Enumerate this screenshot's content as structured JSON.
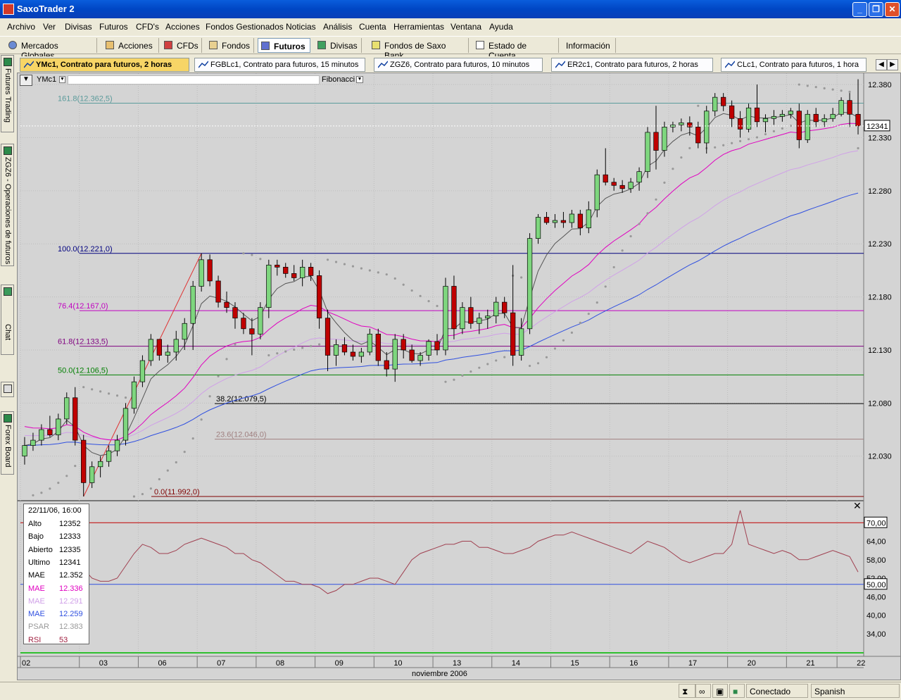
{
  "window": {
    "title": "SaxoTrader 2",
    "btn_min": "_",
    "btn_max": "❐",
    "btn_close": "✕"
  },
  "menu": [
    "Archivo",
    "Ver",
    "Divisas",
    "Futuros",
    "CFD's",
    "Acciones",
    "Fondos Gestionados",
    "Noticias",
    "Análisis",
    "Cuenta",
    "Herramientas",
    "Ventana",
    "Ayuda"
  ],
  "toolbar": [
    "Mercados Globales",
    "Acciones",
    "CFDs",
    "Fondos",
    "Futuros",
    "Divisas",
    "Fondos de Saxo Bank",
    "Estado de Cuenta",
    "Información"
  ],
  "toolbar_active": "Futuros",
  "left_tabs": [
    "Futures Trading",
    "ZGZ6 - Operaciones de futuros",
    "Chat",
    "Forex Board"
  ],
  "doc_tabs": [
    "YMc1, Contrato para futuros, 2 horas",
    "FGBLc1, Contrato para futuros, 15 minutos",
    "ZGZ6, Contrato para futuros, 10 minutos",
    "ER2c1, Contrato para futuros, 2 horas",
    "CLc1, Contrato para futuros, 1 hora"
  ],
  "chart_toolbar": {
    "symbol": "YMc1",
    "study": "Fibonacci"
  },
  "chart_data": {
    "type": "candlestick",
    "symbol": "YMc1",
    "price_axis_labels": [
      "12.380",
      "12.330",
      "12.280",
      "12.230",
      "12.180",
      "12.130",
      "12.080",
      "12.030"
    ],
    "price_range": [
      11990,
      12388
    ],
    "last_price_label": "12341",
    "fibonacci_levels": [
      {
        "label": "161.8(12.362,5)",
        "value": 12362.5,
        "color": "#5b9b9b"
      },
      {
        "label": "100.0(12.221,0)",
        "value": 12221,
        "color": "#00007f"
      },
      {
        "label": "76.4(12.167,0)",
        "value": 12167,
        "color": "#c000c0"
      },
      {
        "label": "61.8(12.133,5)",
        "value": 12133.5,
        "color": "#7f007f"
      },
      {
        "label": "50.0(12.106,5)",
        "value": 12106.5,
        "color": "#007f00"
      },
      {
        "label": "38.2(12.079,5)",
        "value": 12079.5,
        "color": "#000000"
      },
      {
        "label": "23.6(12.046,0)",
        "value": 12046,
        "color": "#9f7f7f"
      },
      {
        "label": "0.0(11.992,0)",
        "value": 11992,
        "color": "#7f0000"
      }
    ],
    "candles": [
      [
        12030,
        12048,
        12022,
        12040
      ],
      [
        12040,
        12052,
        12035,
        12045
      ],
      [
        12045,
        12060,
        12040,
        12055
      ],
      [
        12055,
        12068,
        12048,
        12050
      ],
      [
        12050,
        12070,
        12045,
        12065
      ],
      [
        12065,
        12090,
        12060,
        12085
      ],
      [
        12085,
        12095,
        12040,
        12045
      ],
      [
        12045,
        12050,
        11992,
        12005
      ],
      [
        12005,
        12025,
        12000,
        12020
      ],
      [
        12020,
        12030,
        12010,
        12025
      ],
      [
        12025,
        12040,
        12020,
        12035
      ],
      [
        12035,
        12050,
        12030,
        12045
      ],
      [
        12045,
        12080,
        12040,
        12075
      ],
      [
        12075,
        12105,
        12070,
        12100
      ],
      [
        12100,
        12125,
        12095,
        12120
      ],
      [
        12120,
        12145,
        12115,
        12140
      ],
      [
        12140,
        12140,
        12120,
        12125
      ],
      [
        12125,
        12135,
        12118,
        12128
      ],
      [
        12128,
        12148,
        12120,
        12140
      ],
      [
        12140,
        12160,
        12130,
        12155
      ],
      [
        12155,
        12195,
        12130,
        12190
      ],
      [
        12190,
        12221,
        12185,
        12215
      ],
      [
        12215,
        12220,
        12190,
        12195
      ],
      [
        12195,
        12200,
        12170,
        12175
      ],
      [
        12175,
        12185,
        12165,
        12170
      ],
      [
        12170,
        12175,
        12150,
        12160
      ],
      [
        12160,
        12165,
        12145,
        12150
      ],
      [
        12150,
        12160,
        12125,
        12145
      ],
      [
        12145,
        12175,
        12140,
        12170
      ],
      [
        12170,
        12215,
        12160,
        12210
      ],
      [
        12210,
        12215,
        12200,
        12208
      ],
      [
        12208,
        12212,
        12198,
        12202
      ],
      [
        12202,
        12210,
        12195,
        12198
      ],
      [
        12198,
        12215,
        12190,
        12208
      ],
      [
        12208,
        12212,
        12195,
        12200
      ],
      [
        12200,
        12205,
        12150,
        12160
      ],
      [
        12160,
        12168,
        12110,
        12125
      ],
      [
        12125,
        12140,
        12115,
        12135
      ],
      [
        12135,
        12142,
        12125,
        12128
      ],
      [
        12128,
        12135,
        12120,
        12124
      ],
      [
        12124,
        12132,
        12118,
        12128
      ],
      [
        12128,
        12150,
        12125,
        12145
      ],
      [
        12145,
        12150,
        12115,
        12120
      ],
      [
        12120,
        12128,
        12105,
        12112
      ],
      [
        12112,
        12145,
        12100,
        12140
      ],
      [
        12140,
        12145,
        12122,
        12130
      ],
      [
        12130,
        12135,
        12118,
        12120
      ],
      [
        12120,
        12128,
        12115,
        12125
      ],
      [
        12125,
        12140,
        12120,
        12138
      ],
      [
        12138,
        12145,
        12125,
        12130
      ],
      [
        12130,
        12198,
        12125,
        12190
      ],
      [
        12190,
        12200,
        12140,
        12150
      ],
      [
        12150,
        12175,
        12145,
        12170
      ],
      [
        12170,
        12180,
        12150,
        12155
      ],
      [
        12155,
        12165,
        12145,
        12160
      ],
      [
        12160,
        12168,
        12150,
        12162
      ],
      [
        12162,
        12180,
        12155,
        12175
      ],
      [
        12175,
        12180,
        12160,
        12165
      ],
      [
        12165,
        12210,
        12115,
        12125
      ],
      [
        12125,
        12160,
        12120,
        12150
      ],
      [
        12150,
        12240,
        12145,
        12235
      ],
      [
        12235,
        12258,
        12230,
        12255
      ],
      [
        12255,
        12260,
        12248,
        12250
      ],
      [
        12250,
        12258,
        12245,
        12252
      ],
      [
        12252,
        12260,
        12245,
        12250
      ],
      [
        12250,
        12262,
        12245,
        12258
      ],
      [
        12258,
        12262,
        12238,
        12245
      ],
      [
        12245,
        12270,
        12240,
        12262
      ],
      [
        12262,
        12300,
        12255,
        12295
      ],
      [
        12295,
        12320,
        12285,
        12288
      ],
      [
        12288,
        12292,
        12280,
        12285
      ],
      [
        12285,
        12290,
        12278,
        12282
      ],
      [
        12282,
        12292,
        12278,
        12288
      ],
      [
        12288,
        12302,
        12280,
        12298
      ],
      [
        12298,
        12340,
        12292,
        12335
      ],
      [
        12335,
        12360,
        12300,
        12318
      ],
      [
        12318,
        12345,
        12312,
        12340
      ],
      [
        12340,
        12345,
        12335,
        12342
      ],
      [
        12342,
        12348,
        12336,
        12344
      ],
      [
        12344,
        12350,
        12332,
        12340
      ],
      [
        12340,
        12345,
        12320,
        12325
      ],
      [
        12325,
        12360,
        12315,
        12355
      ],
      [
        12355,
        12372,
        12350,
        12368
      ],
      [
        12368,
        12372,
        12355,
        12360
      ],
      [
        12360,
        12365,
        12340,
        12348
      ],
      [
        12348,
        12355,
        12330,
        12338
      ],
      [
        12338,
        12362,
        12335,
        12358
      ],
      [
        12358,
        12380,
        12340,
        12345
      ],
      [
        12345,
        12352,
        12335,
        12348
      ],
      [
        12348,
        12356,
        12342,
        12350
      ],
      [
        12350,
        12356,
        12345,
        12352
      ],
      [
        12352,
        12358,
        12348,
        12355
      ],
      [
        12355,
        12362,
        12320,
        12328
      ],
      [
        12328,
        12356,
        12325,
        12352
      ],
      [
        12352,
        12358,
        12340,
        12345
      ],
      [
        12345,
        12352,
        12340,
        12348
      ],
      [
        12348,
        12358,
        12345,
        12352
      ],
      [
        12352,
        12368,
        12350,
        12365
      ],
      [
        12365,
        12372,
        12340,
        12352
      ],
      [
        12352,
        12385,
        12333,
        12341
      ]
    ],
    "rsi_axis_labels": [
      "70,00",
      "64,00",
      "58,00",
      "52,00",
      "50,00",
      "46,00",
      "40,00",
      "34,00"
    ],
    "rsi_range": [
      28,
      76
    ],
    "rsi_values": [
      40,
      40,
      41,
      42,
      44,
      48,
      53,
      55,
      52,
      51,
      51,
      52,
      56,
      60,
      63,
      62,
      60,
      60,
      61,
      63,
      64,
      65,
      64,
      63,
      62,
      60,
      60,
      58,
      57,
      55,
      53,
      51,
      51,
      50,
      50,
      49,
      47,
      48,
      50,
      50,
      51,
      52,
      52,
      51,
      50,
      54,
      58,
      60,
      61,
      62,
      63,
      63,
      64,
      64,
      62,
      62,
      61,
      60,
      60,
      61,
      62,
      64,
      65,
      66,
      66,
      67,
      66,
      65,
      64,
      63,
      62,
      61,
      60,
      62,
      64,
      63,
      62,
      60,
      58,
      57,
      58,
      59,
      60,
      60,
      63,
      74,
      63,
      62,
      61,
      60,
      61,
      60,
      58,
      58,
      59,
      60,
      61,
      60,
      59,
      54
    ],
    "legend": {
      "datetime": "22/11/06, 16:00",
      "rows": [
        {
          "label": "Alto",
          "value": "12352",
          "color": "#000000"
        },
        {
          "label": "Bajo",
          "value": "12333",
          "color": "#000000"
        },
        {
          "label": "Abierto",
          "value": "12335",
          "color": "#000000"
        },
        {
          "label": "Ultimo",
          "value": "12341",
          "color": "#000000"
        },
        {
          "label": "MAE",
          "value": "12.352",
          "color": "#000000"
        },
        {
          "label": "MAE",
          "value": "12.336",
          "color": "#e000c0"
        },
        {
          "label": "MAE",
          "value": "12.291",
          "color": "#d0a0e8"
        },
        {
          "label": "MAE",
          "value": "12.259",
          "color": "#3050e0"
        },
        {
          "label": "PSAR",
          "value": "12.383",
          "color": "#999999"
        },
        {
          "label": "RSI",
          "value": "53",
          "color": "#a02040"
        }
      ]
    },
    "x_axis_labels": [
      "02",
      "03",
      "06",
      "07",
      "08",
      "09",
      "10",
      "13",
      "14",
      "15",
      "16",
      "17",
      "20",
      "21",
      "22"
    ],
    "x_axis_title": "noviembre 2006"
  },
  "status": {
    "connection": "Conectado",
    "language": "Spanish"
  },
  "colors": {
    "up_candle": "#7ed67e",
    "down_candle": "#c00000",
    "chart_bg": "#d4d4d4",
    "title_blue": "#0a5ddc"
  }
}
